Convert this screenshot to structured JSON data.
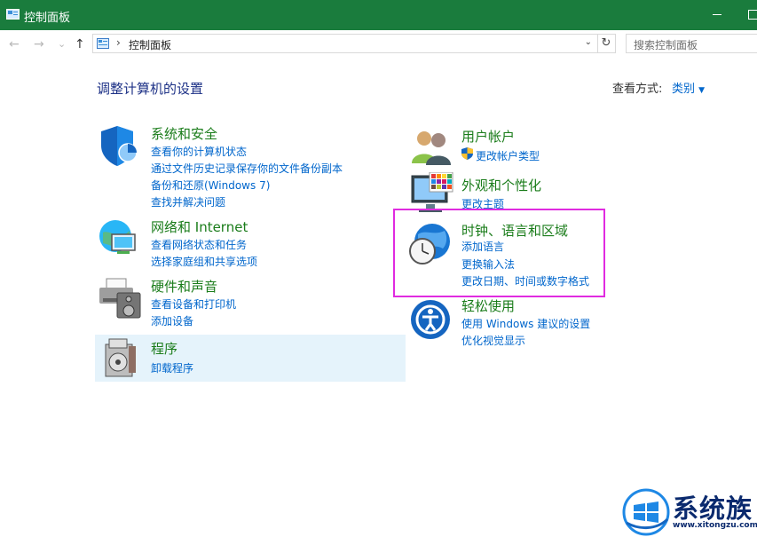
{
  "window": {
    "title": "控制面板"
  },
  "nav": {
    "back": "←",
    "forward": "→",
    "dropdown": "⌄",
    "up": "↑",
    "breadcrumb_sep": "›",
    "breadcrumb": "控制面板",
    "address_dropdown": "⌄",
    "refresh": "↻",
    "search_placeholder": "搜索控制面板"
  },
  "heading": "调整计算机的设置",
  "view_by": {
    "label": "查看方式:",
    "value": "类别"
  },
  "categories": [
    {
      "title": "系统和安全",
      "links": [
        "查看你的计算机状态",
        "通过文件历史记录保存你的文件备份副本",
        "备份和还原(Windows 7)",
        "查找并解决问题"
      ]
    },
    {
      "title": "网络和 Internet",
      "links": [
        "查看网络状态和任务",
        "选择家庭组和共享选项"
      ]
    },
    {
      "title": "硬件和声音",
      "links": [
        "查看设备和打印机",
        "添加设备"
      ]
    },
    {
      "title": "程序",
      "links": [
        "卸载程序"
      ]
    },
    {
      "title": "用户帐户",
      "links": [
        "更改帐户类型"
      ]
    },
    {
      "title": "外观和个性化",
      "links": [
        "更改主题"
      ]
    },
    {
      "title": "时钟、语言和区域",
      "links": [
        "添加语言",
        "更换输入法",
        "更改日期、时间或数字格式"
      ]
    },
    {
      "title": "轻松使用",
      "links": [
        "使用 Windows 建议的设置",
        "优化视觉显示"
      ]
    }
  ],
  "watermark": {
    "text": "系统族",
    "url": "www.xitongzu.com"
  },
  "colors": {
    "titlebar": "#1a7c3d",
    "link": "#0066cc",
    "category_title": "#1a7c1a",
    "highlight": "#e02be0"
  }
}
